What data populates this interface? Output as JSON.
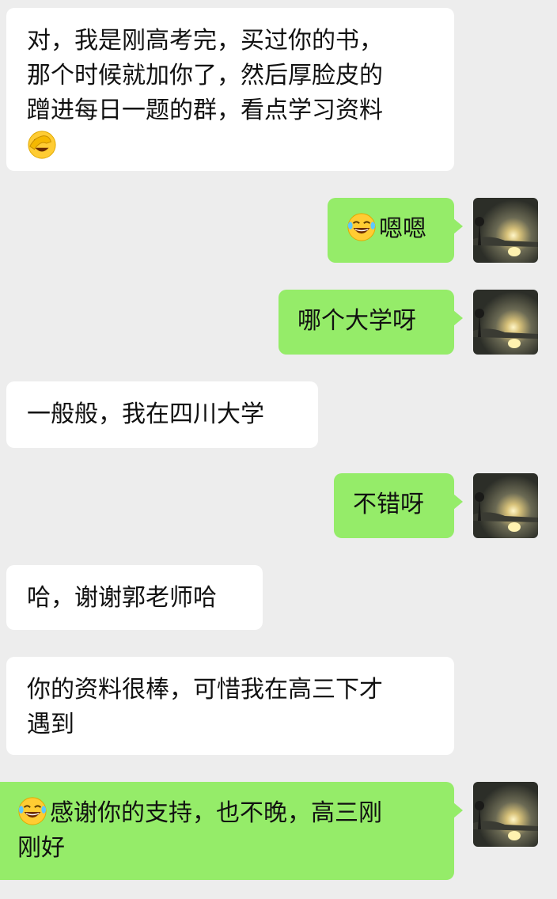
{
  "messages": [
    {
      "side": "in",
      "lines": [
        "对，我是刚高考完，买过你的书，",
        "那个时候就加你了，然后厚脸皮的",
        "蹭进每日一题的群，看点学习资料"
      ],
      "trailing_emoji": "facepalm-emoji-icon"
    },
    {
      "side": "out",
      "emoji": "tears-of-joy-emoji-icon",
      "text": "嗯嗯"
    },
    {
      "side": "out",
      "text": "哪个大学呀"
    },
    {
      "side": "in",
      "text": "一般般，我在四川大学"
    },
    {
      "side": "out",
      "text": "不错呀"
    },
    {
      "side": "in",
      "text": "哈，谢谢郭老师哈"
    },
    {
      "side": "in",
      "lines": [
        "你的资料很棒，可惜我在高三下才",
        "遇到"
      ]
    },
    {
      "side": "out",
      "emoji": "tears-of-joy-emoji-icon",
      "lines": [
        "感谢你的支持，也不晚，高三刚",
        "刚好"
      ]
    }
  ],
  "colors": {
    "background": "#ededed",
    "incoming_bubble": "#ffffff",
    "outgoing_bubble": "#95ec69",
    "text": "#111111"
  },
  "avatar": {
    "icon": "sunset-lake-avatar-icon"
  }
}
